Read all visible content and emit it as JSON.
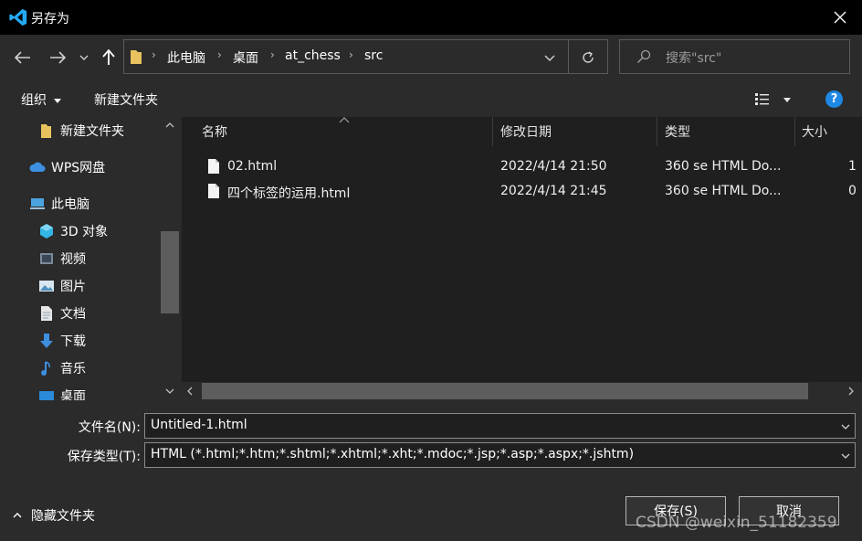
{
  "window": {
    "title": "另存为"
  },
  "nav": {
    "breadcrumb": [
      "此电脑",
      "桌面",
      "at_chess",
      "src"
    ],
    "search_placeholder": "搜索\"src\""
  },
  "toolbar": {
    "organize": "组织",
    "new_folder": "新建文件夹"
  },
  "sidebar": {
    "items": [
      {
        "label": "新建文件夹",
        "icon": "folder-icon"
      },
      {
        "label": "WPS网盘",
        "icon": "cloud-icon"
      },
      {
        "label": "此电脑",
        "icon": "computer-icon"
      },
      {
        "label": "3D 对象",
        "icon": "cube-icon"
      },
      {
        "label": "视频",
        "icon": "video-icon"
      },
      {
        "label": "图片",
        "icon": "picture-icon"
      },
      {
        "label": "文档",
        "icon": "document-icon"
      },
      {
        "label": "下载",
        "icon": "download-icon"
      },
      {
        "label": "音乐",
        "icon": "music-icon"
      },
      {
        "label": "桌面",
        "icon": "desktop-icon"
      }
    ]
  },
  "filelist": {
    "columns": [
      "名称",
      "修改日期",
      "类型",
      "大小"
    ],
    "rows": [
      {
        "name": "02.html",
        "date": "2022/4/14 21:50",
        "type": "360 se HTML Do...",
        "size": "1"
      },
      {
        "name": "四个标签的运用.html",
        "date": "2022/4/14 21:45",
        "type": "360 se HTML Do...",
        "size": "0"
      }
    ]
  },
  "form": {
    "filename_label": "文件名(N):",
    "filename_value": "Untitled-1.html",
    "filetype_label": "保存类型(T):",
    "filetype_value": "HTML (*.html;*.htm;*.shtml;*.xhtml;*.xht;*.mdoc;*.jsp;*.asp;*.aspx;*.jshtm)"
  },
  "footer": {
    "hide_folders": "隐藏文件夹",
    "save": "保存(S)",
    "cancel": "取消",
    "watermark": "CSDN @weixin_51182359"
  },
  "colors": {
    "accent": "#0078d7",
    "folder": "#e8c25e",
    "help": "#1e88e5"
  }
}
